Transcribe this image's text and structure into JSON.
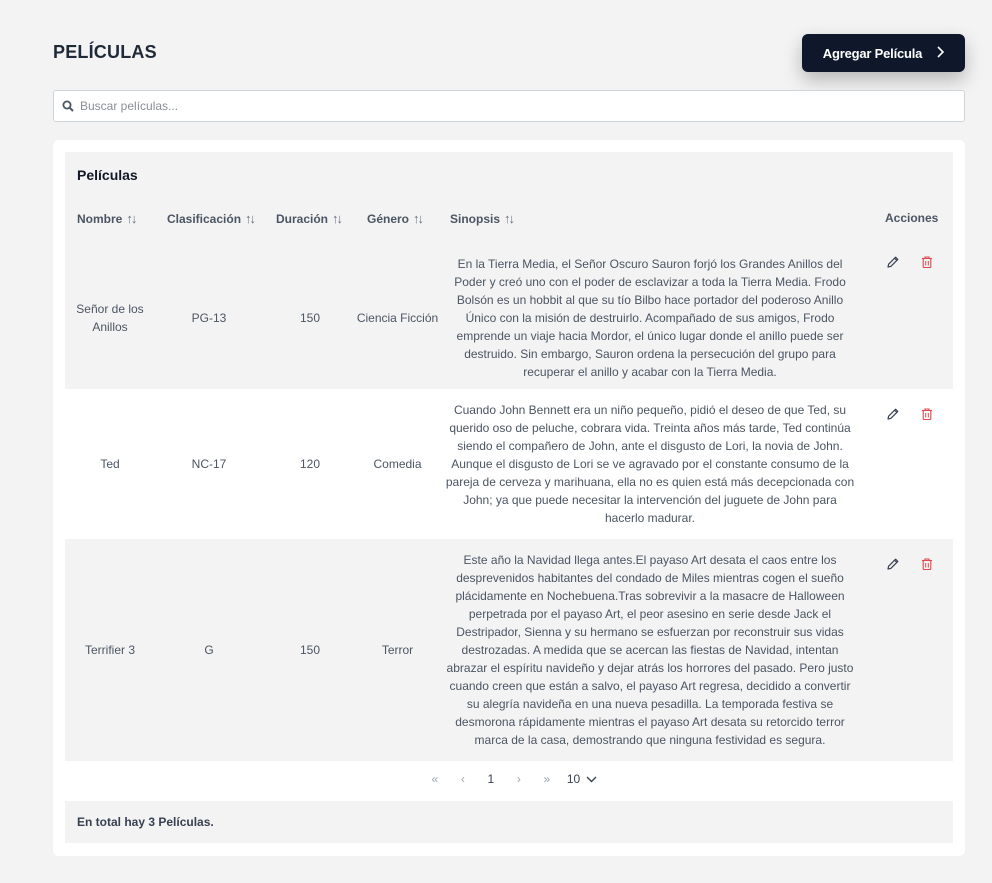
{
  "header": {
    "title": "PELÍCULAS",
    "add_button_label": "Agregar Película",
    "add_button_icon": "chevron-right-icon"
  },
  "search": {
    "placeholder": "Buscar películas...",
    "value": "",
    "icon": "search-icon"
  },
  "table": {
    "title": "Películas",
    "columns": [
      {
        "label": "Nombre",
        "sortable": true
      },
      {
        "label": "Clasificación",
        "sortable": true
      },
      {
        "label": "Duración",
        "sortable": true
      },
      {
        "label": "Género",
        "sortable": true
      },
      {
        "label": "Sinopsis",
        "sortable": true
      },
      {
        "label": "Acciones",
        "sortable": false
      }
    ],
    "sort_icon": "↑↓",
    "rows": [
      {
        "name": "Señor de los Anillos",
        "classification": "PG-13",
        "duration": "150",
        "genre": "Ciencia Ficción",
        "synopsis": "En la Tierra Media, el Señor Oscuro Sauron forjó los Grandes Anillos del Poder y creó uno con el poder de esclavizar a toda la Tierra Media. Frodo Bolsón es un hobbit al que su tío Bilbo hace portador del poderoso Anillo Único con la misión de destruirlo. Acompañado de sus amigos, Frodo emprende un viaje hacia Mordor, el único lugar donde el anillo puede ser destruido. Sin embargo, Sauron ordena la persecución del grupo para recuperar el anillo y acabar con la Tierra Media."
      },
      {
        "name": "Ted",
        "classification": "NC-17",
        "duration": "120",
        "genre": "Comedia",
        "synopsis": "Cuando John Bennett era un niño pequeño, pidió el deseo de que Ted, su querido oso de peluche, cobrara vida. Treinta años más tarde, Ted continúa siendo el compañero de John, ante el disgusto de Lori, la novia de John. Aunque el disgusto de Lori se ve agravado por el constante consumo de la pareja de cerveza y marihuana, ella no es quien está más decepcionada con John; ya que puede necesitar la intervención del juguete de John para hacerlo madurar."
      },
      {
        "name": "Terrifier 3",
        "classification": "G",
        "duration": "150",
        "genre": "Terror",
        "synopsis": "Este año la Navidad llega antes.El payaso Art desata el caos entre los desprevenidos habitantes del condado de Miles mientras cogen el sueño plácidamente en Nochebuena.Tras sobrevivir a la masacre de Halloween perpetrada por el payaso Art, el peor asesino en serie desde Jack el Destripador, Sienna y su hermano se esfuerzan por reconstruir sus vidas destrozadas. A medida que se acercan las fiestas de Navidad, intentan abrazar el espíritu navideño y dejar atrás los horrores del pasado. Pero justo cuando creen que están a salvo, el payaso Art regresa, decidido a convertir su alegría navideña en una nueva pesadilla. La temporada festiva se desmorona rápidamente mientras el payaso Art desata su retorcido terror marca de la casa, demostrando que ninguna festividad es segura."
      }
    ],
    "row_actions": {
      "edit_icon": "pencil-icon",
      "delete_icon": "trash-icon"
    }
  },
  "pagination": {
    "first": "«",
    "prev": "‹",
    "page": "1",
    "next": "›",
    "last": "»",
    "per_page": "10"
  },
  "footer": {
    "summary": "En total hay 3 Películas."
  },
  "colors": {
    "primary_button": "#0f172a",
    "delete": "#e0484d",
    "edit": "#374151",
    "panel_bg": "#f3f3f3"
  }
}
